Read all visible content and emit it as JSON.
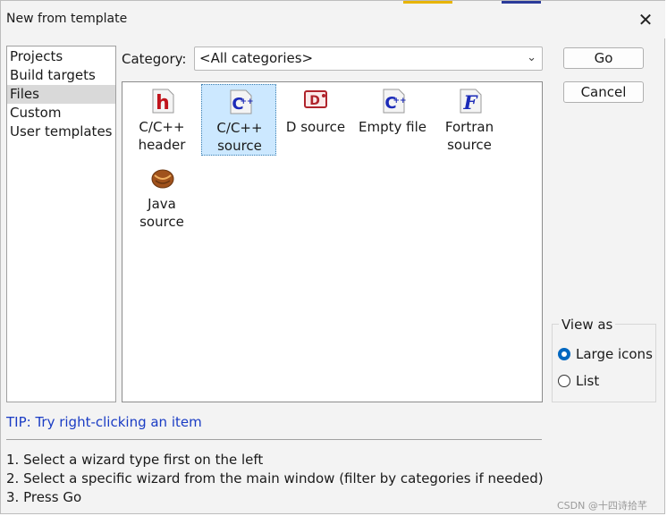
{
  "window": {
    "title": "New from template"
  },
  "left_list": {
    "items": [
      {
        "label": "Projects"
      },
      {
        "label": "Build targets"
      },
      {
        "label": "Files"
      },
      {
        "label": "Custom"
      },
      {
        "label": "User templates"
      }
    ],
    "selected": "Files"
  },
  "category": {
    "label": "Category:",
    "value": "<All categories>"
  },
  "templates": [
    {
      "line1": "C/C++",
      "line2": "header",
      "icon": "h-header-icon"
    },
    {
      "line1": "C/C++",
      "line2": "source",
      "icon": "cpp-source-icon"
    },
    {
      "line1": "D source",
      "line2": "",
      "icon": "d-source-icon"
    },
    {
      "line1": "Empty file",
      "line2": "",
      "icon": "empty-file-icon"
    },
    {
      "line1": "Fortran",
      "line2": "source",
      "icon": "fortran-icon"
    },
    {
      "line1": "Java",
      "line2": "source",
      "icon": "java-coffee-bean-icon"
    }
  ],
  "selected_template": "C/C++ source",
  "buttons": {
    "go": "Go",
    "cancel": "Cancel"
  },
  "view_as": {
    "legend": "View as",
    "options": [
      {
        "label": "Large icons"
      },
      {
        "label": "List"
      }
    ],
    "selected": "Large icons"
  },
  "tip": "TIP: Try right-clicking an item",
  "instructions": [
    "1. Select a wizard type first on the left",
    "2. Select a specific wizard from the main window (filter by categories if needed)",
    "3. Press Go"
  ],
  "watermark": "CSDN @十四诗拾芊",
  "colors": {
    "tip": "#1a3cc4",
    "selection": "#cce8ff",
    "radio_on": "#0067c0"
  }
}
